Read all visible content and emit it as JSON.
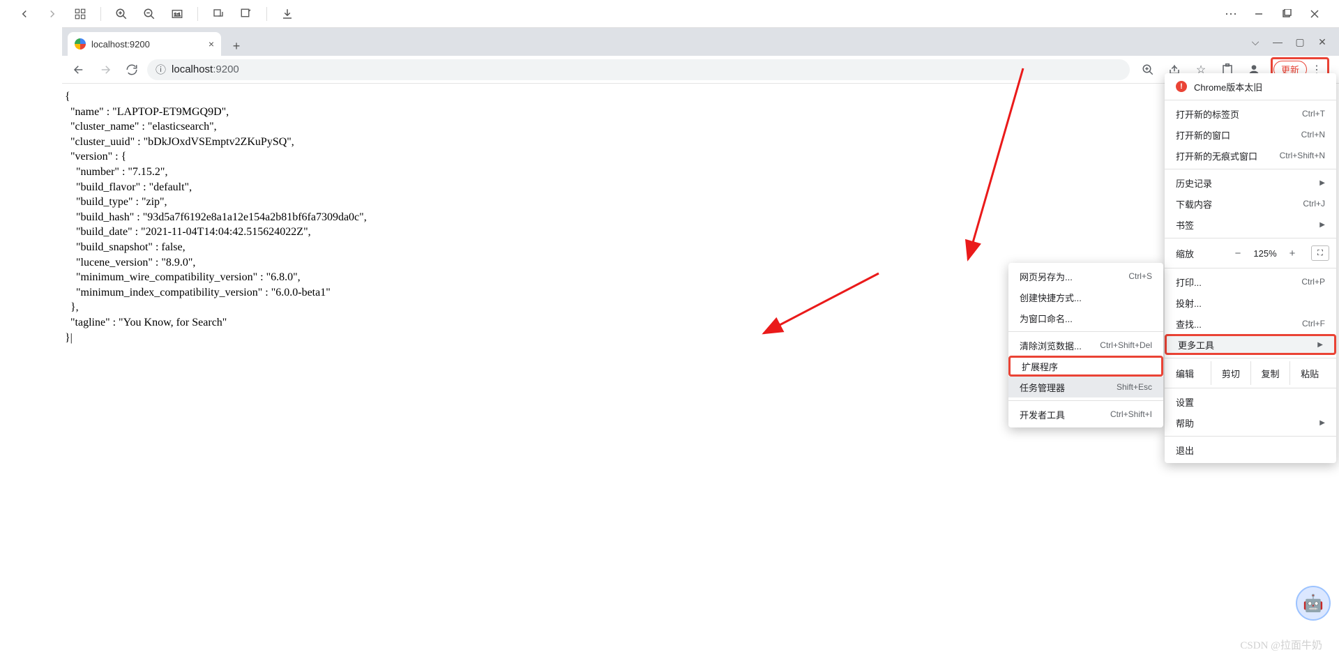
{
  "top_toolbar": {
    "tooltip": "image-viewer-toolbar"
  },
  "browser": {
    "tab": {
      "title": "localhost:9200"
    },
    "url_host": "localhost",
    "url_port": ":9200",
    "update_label": "更新",
    "zoom_value": "125%"
  },
  "page_json": "{\n  \"name\" : \"LAPTOP-ET9MGQ9D\",\n  \"cluster_name\" : \"elasticsearch\",\n  \"cluster_uuid\" : \"bDkJOxdVSEmptv2ZKuPySQ\",\n  \"version\" : {\n    \"number\" : \"7.15.2\",\n    \"build_flavor\" : \"default\",\n    \"build_type\" : \"zip\",\n    \"build_hash\" : \"93d5a7f6192e8a1a12e154a2b81bf6fa7309da0c\",\n    \"build_date\" : \"2021-11-04T14:04:42.515624022Z\",\n    \"build_snapshot\" : false,\n    \"lucene_version\" : \"8.9.0\",\n    \"minimum_wire_compatibility_version\" : \"6.8.0\",\n    \"minimum_index_compatibility_version\" : \"6.0.0-beta1\"\n  },\n  \"tagline\" : \"You Know, for Search\"\n}|",
  "menu": {
    "warn": "Chrome版本太旧",
    "new_tab": "打开新的标签页",
    "new_tab_sc": "Ctrl+T",
    "new_window": "打开新的窗口",
    "new_window_sc": "Ctrl+N",
    "incognito": "打开新的无痕式窗口",
    "incognito_sc": "Ctrl+Shift+N",
    "history": "历史记录",
    "downloads": "下载内容",
    "downloads_sc": "Ctrl+J",
    "bookmarks": "书签",
    "zoom": "缩放",
    "print": "打印...",
    "print_sc": "Ctrl+P",
    "cast": "投射...",
    "find": "查找...",
    "find_sc": "Ctrl+F",
    "more_tools": "更多工具",
    "edit": "编辑",
    "cut": "剪切",
    "copy": "复制",
    "paste": "粘贴",
    "settings": "设置",
    "help": "帮助",
    "exit": "退出"
  },
  "submenu": {
    "save_as": "网页另存为...",
    "save_as_sc": "Ctrl+S",
    "shortcut": "创建快捷方式...",
    "name_window": "为窗口命名...",
    "clear_data": "清除浏览数据...",
    "clear_data_sc": "Ctrl+Shift+Del",
    "extensions": "扩展程序",
    "task_mgr": "任务管理器",
    "task_mgr_sc": "Shift+Esc",
    "dev_tools": "开发者工具",
    "dev_tools_sc": "Ctrl+Shift+I"
  },
  "watermark": "CSDN @拉面牛奶",
  "avatar_emoji": "🤖"
}
